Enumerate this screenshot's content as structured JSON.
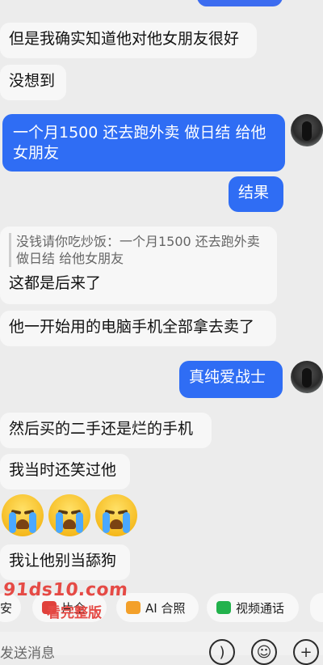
{
  "messages": [
    {
      "side": "left",
      "text": "但是我确实知道他对他女朋友很好"
    },
    {
      "side": "left",
      "text": "没想到"
    },
    {
      "side": "right",
      "text": "一个月1500 还去跑外卖 做日结 给他女朋友"
    },
    {
      "side": "right",
      "text": "结果"
    },
    {
      "side": "left",
      "quote": "没钱请你吃炒饭：一个月1500 还去跑外卖 做日结 给他女朋友",
      "text": "这都是后来了"
    },
    {
      "side": "left",
      "text": "他一开始用的电脑手机全部拿去卖了"
    },
    {
      "side": "right",
      "text": "真纯爱战士"
    },
    {
      "side": "left",
      "text": "然后买的二手还是烂的手机"
    },
    {
      "side": "left",
      "text": "我当时还笑过他"
    },
    {
      "side": "left",
      "text": "我让他别当舔狗"
    }
  ],
  "emoji": [
    "loudly-crying-face",
    "loudly-crying-face",
    "loudly-crying-face"
  ],
  "toolbar": {
    "chip1": "安",
    "chip2": "片全",
    "chip3": "AI 合照",
    "chip4": "视频通话"
  },
  "watermark": {
    "line1": "91ds10.com",
    "line2": "看完整版"
  },
  "composer": {
    "placeholder": "发送消息"
  },
  "colors": {
    "outgoing": "#2f6df4",
    "incoming": "#f7f7f7",
    "background": "#ececec",
    "watermark": "#e54a45"
  }
}
